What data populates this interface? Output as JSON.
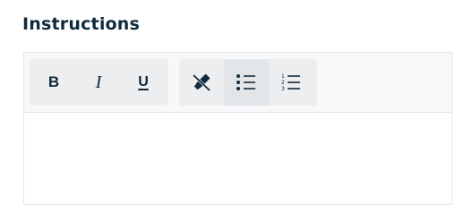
{
  "section": {
    "title": "Instructions"
  },
  "toolbar": {
    "bold_label": "B",
    "italic_label": "I",
    "underline_label": "U",
    "clear_format_icon": "clear-formatting-icon",
    "bullet_list_icon": "bullet-list-icon",
    "numbered_list_icon": "numbered-list-icon",
    "active_button": "bullet-list"
  },
  "editor": {
    "content": ""
  },
  "colors": {
    "text": "#0f2a3d",
    "toolbar_bg": "#f7f8f9",
    "group_bg": "#eceef0",
    "active_bg": "#e3e6e9",
    "border": "#e3e6e8"
  }
}
